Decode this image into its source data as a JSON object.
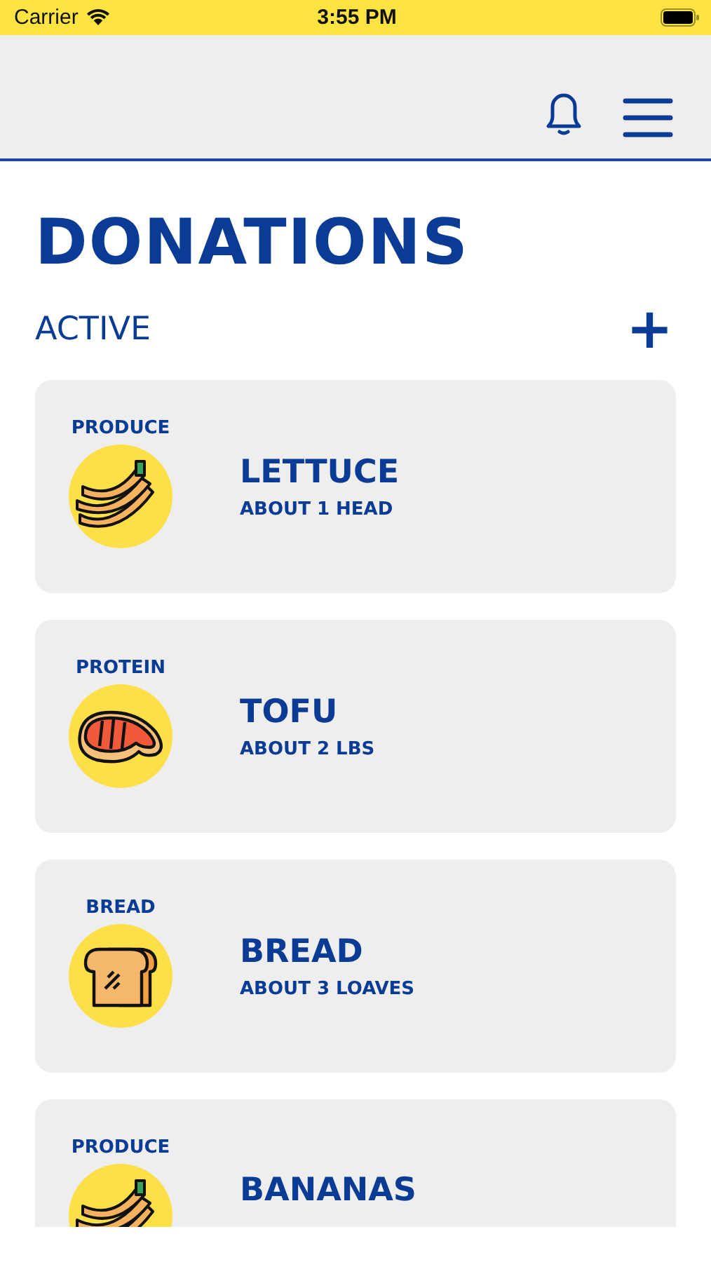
{
  "status_bar": {
    "carrier": "Carrier",
    "time": "3:55 PM"
  },
  "title": "DONATIONS",
  "section": {
    "label": "ACTIVE",
    "add_symbol": "+"
  },
  "donations": [
    {
      "category": "PRODUCE",
      "name": "LETTUCE",
      "amount": "ABOUT 1 HEAD",
      "kind": "banana"
    },
    {
      "category": "PROTEIN",
      "name": "TOFU",
      "amount": "ABOUT 2 LBS",
      "kind": "meat"
    },
    {
      "category": "BREAD",
      "name": "BREAD",
      "amount": "ABOUT 3 LOAVES",
      "kind": "bread"
    },
    {
      "category": "PRODUCE",
      "name": "BANANAS",
      "kind": "banana"
    }
  ]
}
